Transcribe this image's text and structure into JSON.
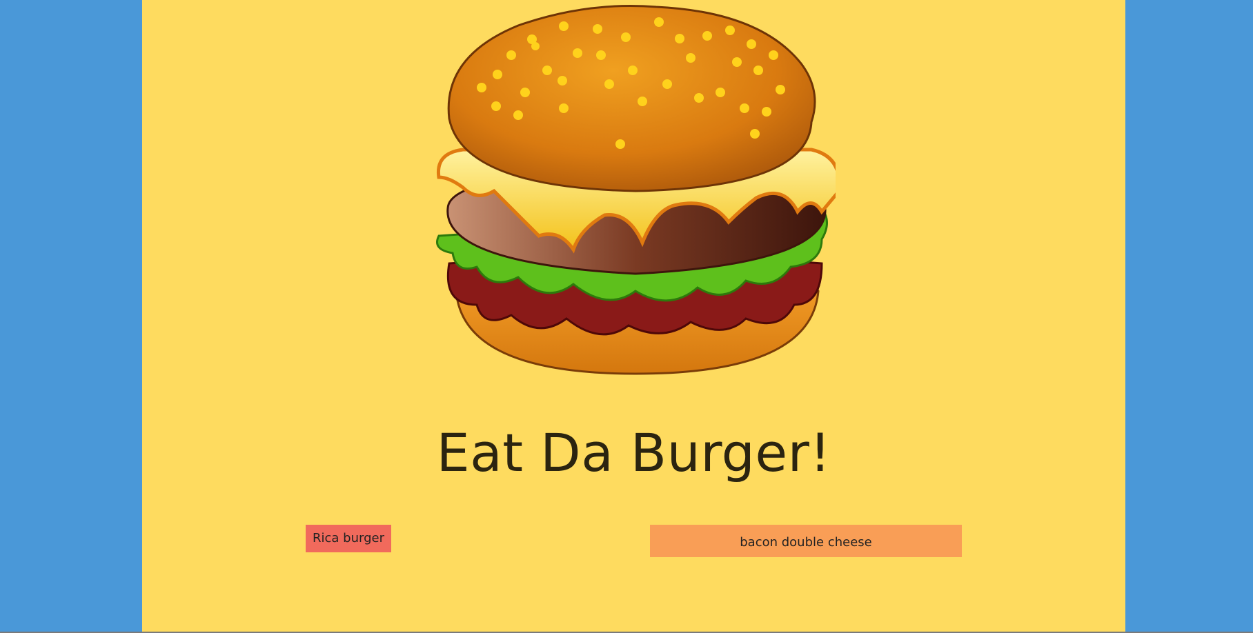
{
  "header": {
    "title": "Eat Da Burger!"
  },
  "burgers": {
    "uneaten": [
      {
        "name": "Rica burger"
      }
    ],
    "eaten": [
      {
        "name": "bacon double cheese"
      }
    ]
  },
  "colors": {
    "background": "#4a98d8",
    "page": "#fedb5f",
    "uneaten_button": "#f16a5c",
    "eaten_button": "#f99e56"
  },
  "images": {
    "hero": "burger-logo"
  }
}
